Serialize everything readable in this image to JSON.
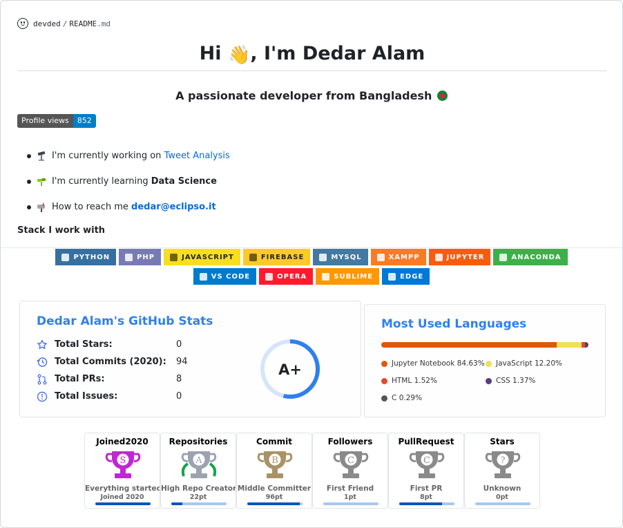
{
  "breadcrumb": {
    "owner": "devded",
    "separator": "/",
    "file": "README",
    "ext": ".md"
  },
  "header": {
    "title_pre": "Hi ",
    "title_emoji": "👋",
    "title_post": ", I'm Dedar Alam"
  },
  "subtitle": "A passionate developer from Bangladesh",
  "views_badge": {
    "label": "Profile views",
    "value": "852"
  },
  "bullets": [
    {
      "text": "I'm currently working on ",
      "link": "Tweet Analysis",
      "icon": "telescope-icon"
    },
    {
      "text": "I'm currently learning ",
      "strong": "Data Science",
      "icon": "seedling-icon"
    },
    {
      "text": "How to reach me ",
      "link_strong": "dedar@eclipso.it",
      "icon": "mailbox-icon"
    }
  ],
  "stack_heading": "Stack I work with",
  "badges": [
    {
      "label": "PYTHON",
      "color": "#3670A0"
    },
    {
      "label": "PHP",
      "color": "#777BB4"
    },
    {
      "label": "JAVASCRIPT",
      "color": "#F7DF1E",
      "dark": true
    },
    {
      "label": "FIREBASE",
      "color": "#FFCA28",
      "dark": true
    },
    {
      "label": "MYSQL",
      "color": "#4479A1"
    },
    {
      "label": "XAMPP",
      "color": "#FB7A24"
    },
    {
      "label": "JUPYTER",
      "color": "#FA5B0F"
    },
    {
      "label": "ANACONDA",
      "color": "#3EB049"
    },
    {
      "label": "VS CODE",
      "color": "#007ACC"
    },
    {
      "label": "OPERA",
      "color": "#FF1B2D"
    },
    {
      "label": "SUBLIME",
      "color": "#FF9800"
    },
    {
      "label": "EDGE",
      "color": "#0078D7"
    }
  ],
  "stats": {
    "title": "Dedar Alam's GitHub Stats",
    "rows": [
      {
        "label": "Total Stars:",
        "value": "0",
        "icon": "star-icon"
      },
      {
        "label": "Total Commits (2020):",
        "value": "94",
        "icon": "history-icon"
      },
      {
        "label": "Total PRs:",
        "value": "8",
        "icon": "pull-request-icon"
      },
      {
        "label": "Total Issues:",
        "value": "0",
        "icon": "issue-icon"
      }
    ],
    "grade": "A+",
    "accent": "#2f80ed"
  },
  "languages": {
    "title": "Most Used Languages",
    "items": [
      {
        "name": "Jupyter Notebook",
        "percent": "84.63%",
        "share": 84.63,
        "color": "#DA5B0B"
      },
      {
        "name": "JavaScript",
        "percent": "12.20%",
        "share": 12.2,
        "color": "#F1E05A"
      },
      {
        "name": "HTML",
        "percent": "1.52%",
        "share": 1.52,
        "color": "#E34C26"
      },
      {
        "name": "CSS",
        "percent": "1.37%",
        "share": 1.37,
        "color": "#563D7C"
      },
      {
        "name": "C",
        "percent": "0.29%",
        "share": 0.29,
        "color": "#555555"
      }
    ]
  },
  "trophies": [
    {
      "title": "Joined2020",
      "rank": "S",
      "desc": "Everything started...",
      "pts": "Joined 2020",
      "progress": 1.0,
      "color": "#c026d3",
      "laurel": false
    },
    {
      "title": "Repositories",
      "rank": "A",
      "desc": "High Repo Creator",
      "pts": "22pt",
      "progress": 0.2,
      "color": "#9ca3af",
      "laurel": true
    },
    {
      "title": "Commit",
      "rank": "B",
      "desc": "Middle Committer",
      "pts": "96pt",
      "progress": 0.95,
      "color": "#a89266",
      "laurel": false
    },
    {
      "title": "Followers",
      "rank": "C",
      "desc": "First Friend",
      "pts": "1pt",
      "progress": 0.0,
      "color": "#8a8a8a",
      "laurel": false
    },
    {
      "title": "PullRequest",
      "rank": "C",
      "desc": "First PR",
      "pts": "8pt",
      "progress": 0.78,
      "color": "#8a8a8a",
      "laurel": false
    },
    {
      "title": "Stars",
      "rank": "?",
      "desc": "Unknown",
      "pts": "0pt",
      "progress": 0.0,
      "color": "#8a8a8a",
      "laurel": false
    }
  ]
}
